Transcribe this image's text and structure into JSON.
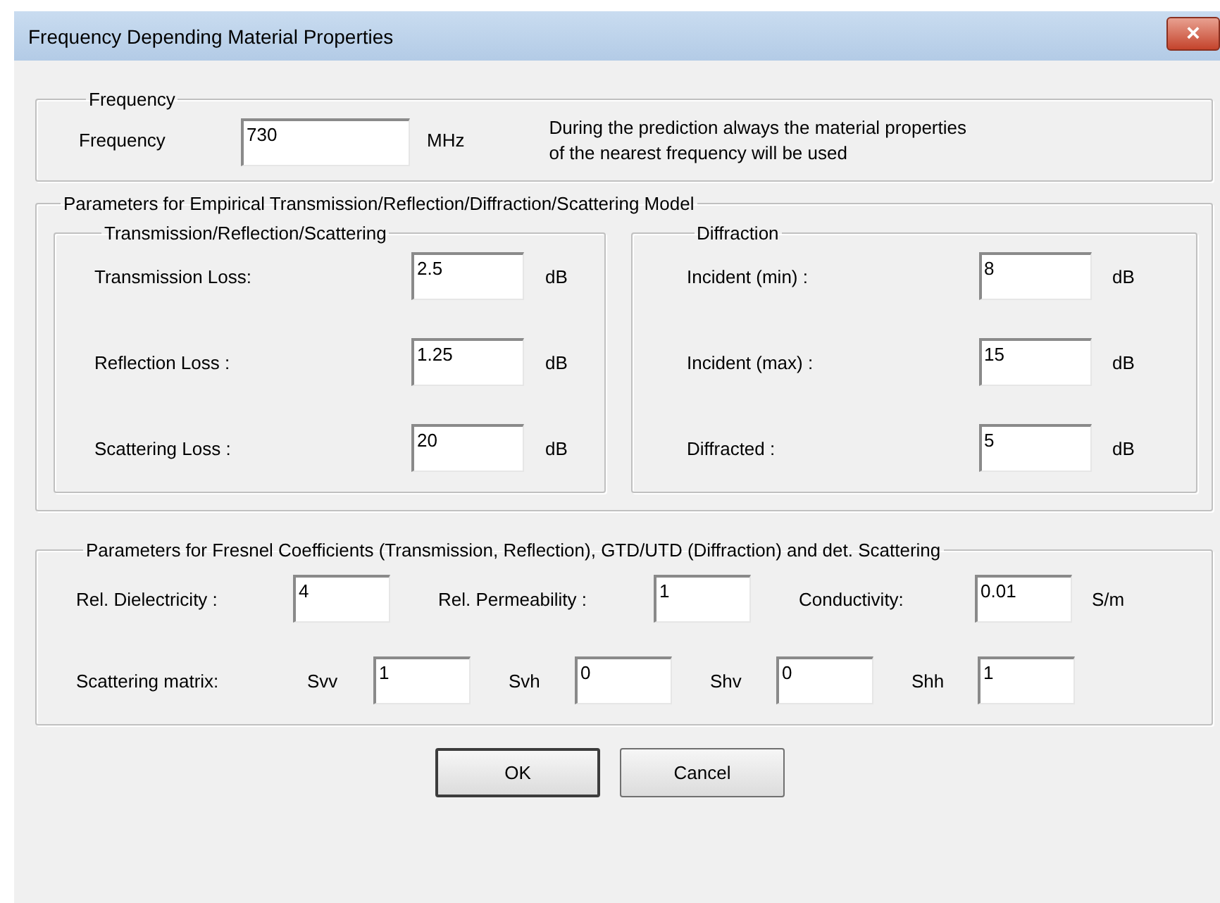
{
  "window": {
    "title": "Frequency Depending Material Properties",
    "close": "×"
  },
  "frequency_group": {
    "title": "Frequency",
    "label": "Frequency",
    "value": "730",
    "unit": "MHz",
    "note": "During the prediction always the material properties\nof the nearest frequency will be used"
  },
  "empirical_group": {
    "title": "Parameters for Empirical Transmission/Reflection/Diffraction/Scattering Model",
    "subgroups": [
      {
        "title": "Transmission/Reflection/Scattering",
        "rows": [
          {
            "label": "Transmission Loss:",
            "value": "2.5",
            "unit": "dB"
          },
          {
            "label": "Reflection Loss :",
            "value": "1.25",
            "unit": "dB"
          },
          {
            "label": "Scattering Loss :",
            "value": "20",
            "unit": "dB"
          }
        ]
      },
      {
        "title": "Diffraction",
        "rows": [
          {
            "label": "Incident (min) :",
            "value": "8",
            "unit": "dB"
          },
          {
            "label": "Incident (max) :",
            "value": "15",
            "unit": "dB"
          },
          {
            "label": "Diffracted :",
            "value": "5",
            "unit": "dB"
          }
        ]
      }
    ]
  },
  "fresnel_group": {
    "title": "Parameters for Fresnel Coefficients (Transmission, Reflection), GTD/UTD (Diffraction) and det. Scattering",
    "rows": [
      {
        "kind": "properties",
        "fields": [
          {
            "label": "Rel. Dielectricity :",
            "value": "4"
          },
          {
            "label": "Rel. Permeability :",
            "value": "1"
          },
          {
            "label": "Conductivity:",
            "value": "0.01",
            "unit": "S/m"
          }
        ]
      },
      {
        "kind": "matrix",
        "label": "Scattering matrix:",
        "fields": [
          {
            "label": "Svv",
            "value": "1"
          },
          {
            "label": "Svh",
            "value": "0"
          },
          {
            "label": "Shv",
            "value": "0"
          },
          {
            "label": "Shh",
            "value": "1"
          }
        ]
      }
    ]
  },
  "buttons": [
    "OK",
    "Cancel"
  ]
}
